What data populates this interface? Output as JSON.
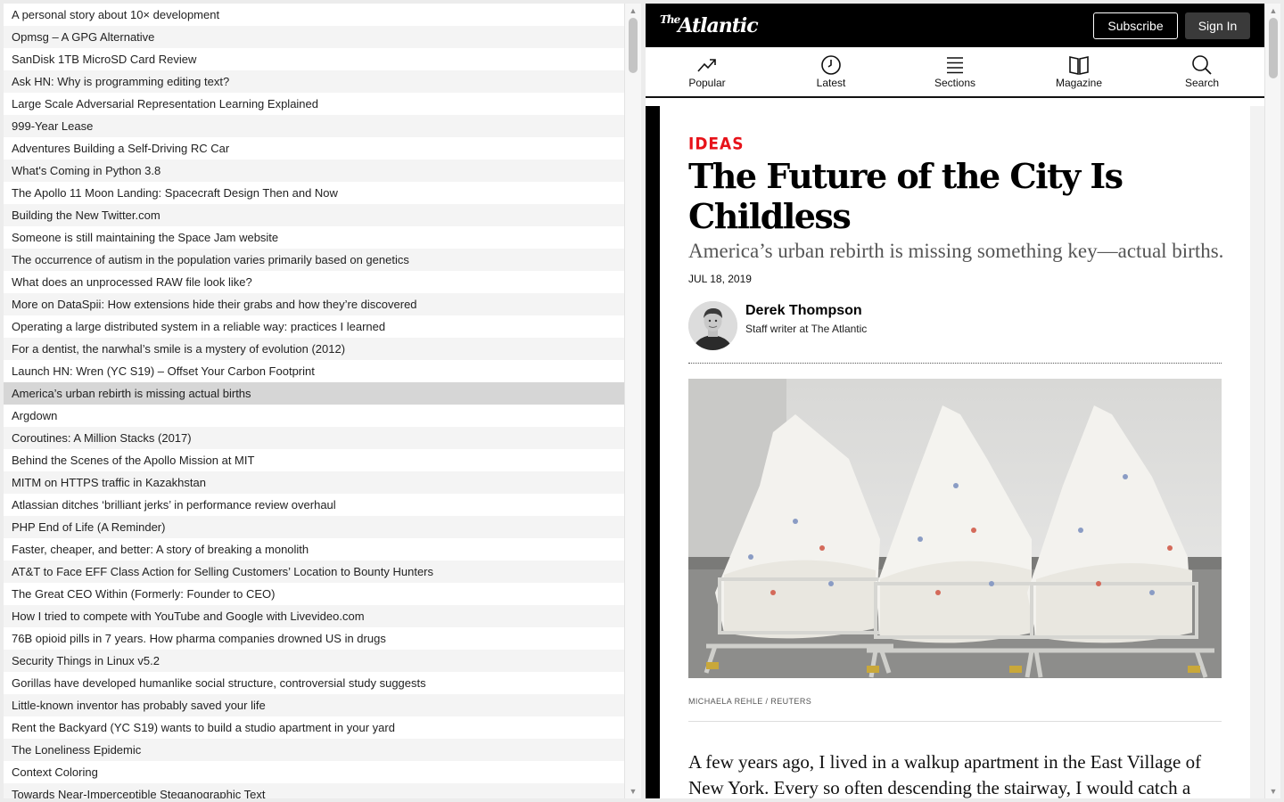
{
  "story_list": {
    "selected_index": 17,
    "items": [
      "A personal story about 10× development",
      "Opmsg – A GPG Alternative",
      "SanDisk 1TB MicroSD Card Review",
      "Ask HN: Why is programming editing text?",
      "Large Scale Adversarial Representation Learning Explained",
      "999-Year Lease",
      "Adventures Building a Self-Driving RC Car",
      "What's Coming in Python 3.8",
      "The Apollo 11 Moon Landing: Spacecraft Design Then and Now",
      "Building the New Twitter.com",
      "Someone is still maintaining the Space Jam website",
      "The occurrence of autism in the population varies primarily based on genetics",
      "What does an unprocessed RAW file look like?",
      "More on DataSpii: How extensions hide their grabs and how they’re discovered",
      "Operating a large distributed system in a reliable way: practices I learned",
      "For a dentist, the narwhal’s smile is a mystery of evolution (2012)",
      "Launch HN: Wren (YC S19) – Offset Your Carbon Footprint",
      "America’s urban rebirth is missing actual births",
      "Argdown",
      "Coroutines: A Million Stacks (2017)",
      "Behind the Scenes of the Apollo Mission at MIT",
      "MITM on HTTPS traffic in Kazakhstan",
      "Atlassian ditches ‘brilliant jerks’ in performance review overhaul",
      "PHP End of Life (A Reminder)",
      "Faster, cheaper, and better: A story of breaking a monolith",
      "AT&T to Face EFF Class Action for Selling Customers’ Location to Bounty Hunters",
      "The Great CEO Within (Formerly: Founder to CEO)",
      "How I tried to compete with YouTube and Google with Livevideo.com",
      "76B opioid pills in 7 years. How pharma companies drowned US in drugs",
      "Security Things in Linux v5.2",
      "Gorillas have developed humanlike social structure, controversial study suggests",
      "Little-known inventor has probably saved your life",
      "Rent the Backyard (YC S19) wants to build a studio apartment in your yard",
      "The Loneliness Epidemic",
      "Context Coloring",
      "Towards Near-Imperceptible Steganographic Text"
    ]
  },
  "browser": {
    "header": {
      "logo_small": "The",
      "logo_big": "Atlantic",
      "subscribe_label": "Subscribe",
      "signin_label": "Sign In",
      "background": "#000000"
    },
    "nav": [
      {
        "label": "Popular",
        "icon": "trending-up-icon"
      },
      {
        "label": "Latest",
        "icon": "clock-icon"
      },
      {
        "label": "Sections",
        "icon": "menu-icon"
      },
      {
        "label": "Magazine",
        "icon": "open-book-icon"
      },
      {
        "label": "Search",
        "icon": "search-icon"
      }
    ],
    "article": {
      "section": "IDEAS",
      "section_color": "#e7131a",
      "headline": "The Future of the City Is Childless",
      "dek": "America’s urban rebirth is missing something key—actual births.",
      "date": "JUL 18, 2019",
      "author_name": "Derek Thompson",
      "author_title": "Staff writer at The Atlantic",
      "photo_credit": "MICHAELA REHLE / REUTERS",
      "body_start": "A few years ago, I lived in a walkup apartment in the East Village of New York. Every so often descending the stairway, I would catch a"
    }
  }
}
